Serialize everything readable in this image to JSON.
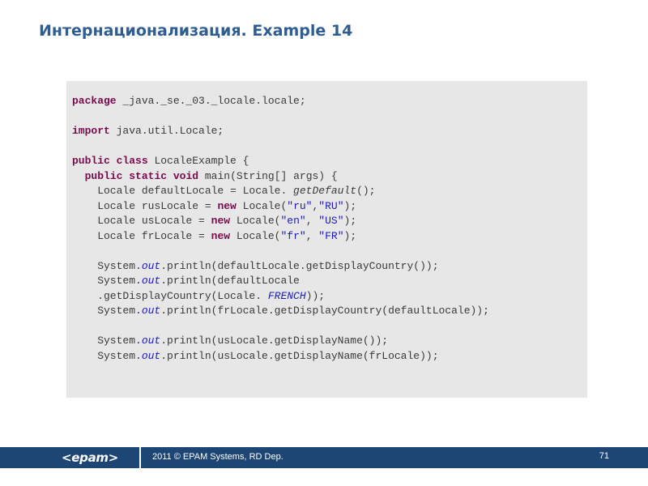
{
  "slide": {
    "title": "Интернационализация. Example 14",
    "code": [
      {
        "segments": [
          {
            "t": "package",
            "c": "kw"
          },
          {
            "t": " _java._se._03._locale.locale;",
            "c": ""
          }
        ]
      },
      {
        "segments": []
      },
      {
        "segments": [
          {
            "t": "import",
            "c": "kw"
          },
          {
            "t": " java.util.Locale;",
            "c": ""
          }
        ]
      },
      {
        "segments": []
      },
      {
        "segments": [
          {
            "t": "public",
            "c": "kw"
          },
          {
            "t": " ",
            "c": ""
          },
          {
            "t": "class",
            "c": "kw"
          },
          {
            "t": " LocaleExample {",
            "c": ""
          }
        ]
      },
      {
        "segments": [
          {
            "t": "  ",
            "c": ""
          },
          {
            "t": "public",
            "c": "kw"
          },
          {
            "t": " ",
            "c": ""
          },
          {
            "t": "static",
            "c": "kw"
          },
          {
            "t": " ",
            "c": ""
          },
          {
            "t": "void",
            "c": "kw"
          },
          {
            "t": " main(String[] args) {",
            "c": ""
          }
        ]
      },
      {
        "segments": [
          {
            "t": "    Locale defaultLocale = Locale. ",
            "c": ""
          },
          {
            "t": "getDefault",
            "c": "mth"
          },
          {
            "t": "();",
            "c": ""
          }
        ]
      },
      {
        "segments": [
          {
            "t": "    Locale rusLocale = ",
            "c": ""
          },
          {
            "t": "new",
            "c": "kw"
          },
          {
            "t": " Locale(",
            "c": ""
          },
          {
            "t": "\"ru\"",
            "c": "str"
          },
          {
            "t": ",",
            "c": ""
          },
          {
            "t": "\"RU\"",
            "c": "str"
          },
          {
            "t": ");",
            "c": ""
          }
        ]
      },
      {
        "segments": [
          {
            "t": "    Locale usLocale = ",
            "c": ""
          },
          {
            "t": "new",
            "c": "kw"
          },
          {
            "t": " Locale(",
            "c": ""
          },
          {
            "t": "\"en\"",
            "c": "str"
          },
          {
            "t": ", ",
            "c": ""
          },
          {
            "t": "\"US\"",
            "c": "str"
          },
          {
            "t": ");",
            "c": ""
          }
        ]
      },
      {
        "segments": [
          {
            "t": "    Locale frLocale = ",
            "c": ""
          },
          {
            "t": "new",
            "c": "kw"
          },
          {
            "t": " Locale(",
            "c": ""
          },
          {
            "t": "\"fr\"",
            "c": "str"
          },
          {
            "t": ", ",
            "c": ""
          },
          {
            "t": "\"FR\"",
            "c": "str"
          },
          {
            "t": ");",
            "c": ""
          }
        ]
      },
      {
        "segments": []
      },
      {
        "segments": [
          {
            "t": "    System.",
            "c": ""
          },
          {
            "t": "out",
            "c": "fld"
          },
          {
            "t": ".println(defaultLocale.getDisplayCountry());",
            "c": ""
          }
        ]
      },
      {
        "segments": [
          {
            "t": "    System.",
            "c": ""
          },
          {
            "t": "out",
            "c": "fld"
          },
          {
            "t": ".println(defaultLocale",
            "c": ""
          }
        ]
      },
      {
        "segments": [
          {
            "t": "    .getDisplayCountry(Locale. ",
            "c": ""
          },
          {
            "t": "FRENCH",
            "c": "fld"
          },
          {
            "t": "));",
            "c": ""
          }
        ]
      },
      {
        "segments": [
          {
            "t": "    System.",
            "c": ""
          },
          {
            "t": "out",
            "c": "fld"
          },
          {
            "t": ".println(frLocale.getDisplayCountry(defaultLocale));",
            "c": ""
          }
        ]
      },
      {
        "segments": []
      },
      {
        "segments": [
          {
            "t": "    System.",
            "c": ""
          },
          {
            "t": "out",
            "c": "fld"
          },
          {
            "t": ".println(usLocale.getDisplayName());",
            "c": ""
          }
        ]
      },
      {
        "segments": [
          {
            "t": "    System.",
            "c": ""
          },
          {
            "t": "out",
            "c": "fld"
          },
          {
            "t": ".println(usLocale.getDisplayName(frLocale));",
            "c": ""
          }
        ]
      }
    ]
  },
  "footer": {
    "logo_text": "<epam>",
    "copyright": "2011 © EPAM Systems, RD Dep.",
    "page_number": "71"
  },
  "colors": {
    "title": "#2f5d91",
    "keyword": "#7a0a4e",
    "string_and_field": "#1b1bbf",
    "code_background": "#e7e7e7",
    "footer_background": "#1e4674"
  }
}
